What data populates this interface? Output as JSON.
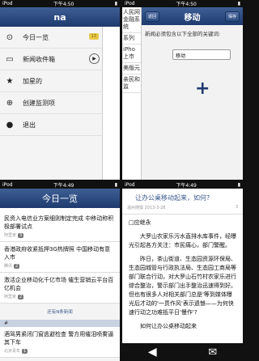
{
  "status": {
    "carrier": "iPod",
    "time": "下午4:50",
    "time2": "下午4:49"
  },
  "menu": {
    "title": "na",
    "items": [
      {
        "label": "今日一览",
        "badge": "13"
      },
      {
        "label": "新闻收件箱"
      },
      {
        "label": "加星的"
      },
      {
        "label": "创建监测项"
      },
      {
        "label": "退出"
      }
    ]
  },
  "keyword": {
    "title": "移动",
    "back": "返回",
    "save": "保存",
    "hint": "新闻必须包含以下全部的关键词:",
    "value": "移动",
    "peek": [
      "人民网金融系统",
      "系列",
      "iPho上市",
      "美版元",
      "亲民和监"
    ]
  },
  "today": {
    "title": "今日一览",
    "items": [
      {
        "title": "民资入电信业方案细则制定完成 中移动称积极部署试点",
        "meta": "阿里家",
        "count": "3"
      },
      {
        "title": "香港政府收紧抵押3G热牌照 中国移动有意入市",
        "meta": "腾讯",
        "count": "2"
      },
      {
        "title": "激活企业移动化千亿市场 催生营销云平台百亿机会",
        "meta": "阿里家",
        "count": "2"
      }
    ],
    "more": "还有N条新闻",
    "section": "#",
    "items2": [
      {
        "title": "酒驾男紧闭门窗逃避检查 警方用催泪喷雾逼其下车",
        "meta": "北京青年",
        "count": "1"
      }
    ]
  },
  "article": {
    "title": "让办公桌移动起来，如何?",
    "source": "温州搜狐",
    "date": "2013-3-28",
    "count": "3",
    "author": "□应继永",
    "paras": [
      "大罗山农家乐污水直排水库事件，经曝光引起各方关注：市民痛心，部门警醒。",
      "昨日，茶山街道、生态园资源环保局、生态园城管与行政执法局、生态园工商局等部门联合行动，对大罗山石竹村农家乐进行综合整治，警示部门出手整治迅速得到好。但也有很多人对相关部门总是'等到媒体曝光后才动的'一贯作风'表示遗憾——为何快速行动之功难抵平日'慢作'?",
      "如何让办公桌移动起来"
    ]
  }
}
